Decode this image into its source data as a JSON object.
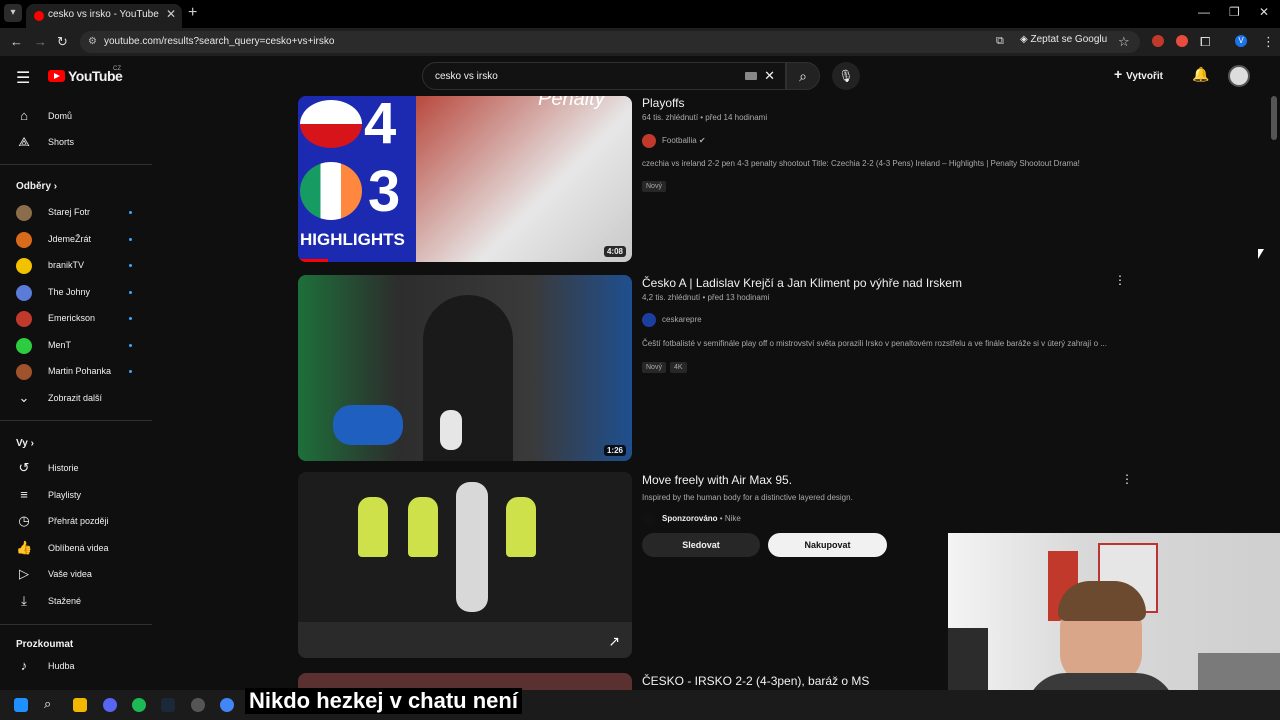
{
  "browser": {
    "tab_title": "cesko vs irsko - YouTube",
    "url": "youtube.com/results?search_query=cesko+vs+irsko",
    "ask_google": "Zeptat se Googlu",
    "profile_initial": "V"
  },
  "yt": {
    "wordmark": "YouTube",
    "country": "CZ",
    "search_value": "cesko vs irsko",
    "create_label": "Vytvořit"
  },
  "sidebar": {
    "main": [
      {
        "label": "Domů",
        "icon": "home-icon"
      },
      {
        "label": "Shorts",
        "icon": "shorts-icon"
      }
    ],
    "subs_header": "Odběry",
    "subs": [
      {
        "label": "Starej Fotr",
        "color": "#8a6d4a"
      },
      {
        "label": "JdemeŽrát",
        "color": "#d96a1a"
      },
      {
        "label": "branikTV",
        "color": "#f2c200"
      },
      {
        "label": "The Johny",
        "color": "#5a7bd8"
      },
      {
        "label": "Emerickson",
        "color": "#c0392b"
      },
      {
        "label": "MenT",
        "color": "#2ecc40"
      },
      {
        "label": "Martin Pohanka",
        "color": "#a0522d"
      }
    ],
    "show_more": "Zobrazit další",
    "you_header": "Vy",
    "you": [
      {
        "label": "Historie",
        "icon": "history-icon"
      },
      {
        "label": "Playlisty",
        "icon": "playlist-icon"
      },
      {
        "label": "Přehrát později",
        "icon": "watch-later-icon"
      },
      {
        "label": "Oblíbená videa",
        "icon": "like-icon"
      },
      {
        "label": "Vaše videa",
        "icon": "your-videos-icon"
      },
      {
        "label": "Stažené",
        "icon": "download-icon"
      }
    ],
    "explore_header": "Prozkoumat",
    "explore": [
      {
        "label": "Hudba",
        "icon": "music-icon"
      }
    ]
  },
  "results": [
    {
      "title": "Playoffs",
      "meta": "64 tis. zhlédnutí • před 14 hodinami",
      "channel": "Footballia",
      "verified": true,
      "desc": "czechia vs ireland 2-2 pen 4-3 penalty shootout Title: Czechia 2-2 (4-3 Pens) Ireland – Highlights | Penalty Shootout Drama!",
      "badges": [
        "Nový"
      ],
      "duration": "4:08",
      "thumb_text_top": "4",
      "thumb_text_mid": "3",
      "thumb_text_bottom": "HIGHLIGHTS",
      "thumb_corner_text": "Penalty"
    },
    {
      "title": "Česko A | Ladislav Krejčí a Jan Kliment po výhře nad Irskem",
      "meta": "4,2 tis. zhlédnutí • před 13 hodinami",
      "channel": "ceskarepre",
      "desc": "Čeští fotbalisté v semifinále play off o mistrovství světa porazili Irsko v penaltovém rozstřelu a ve finále baráže si v úterý zahrají o ...",
      "badges": [
        "Nový",
        "4K"
      ],
      "duration": "1:26"
    },
    {
      "title": "Move freely with Air Max 95.",
      "subtitle": "Inspired by the human body for a distinctive layered design.",
      "sponsored": "Sponzorováno",
      "channel": "Nike",
      "follow_label": "Sledovat",
      "shop_label": "Nakupovat"
    },
    {
      "title": "ČESKO - IRSKO 2-2 (4-3pen), baráž o MS"
    }
  ],
  "caption": "Nikdo hezkej v chatu není"
}
